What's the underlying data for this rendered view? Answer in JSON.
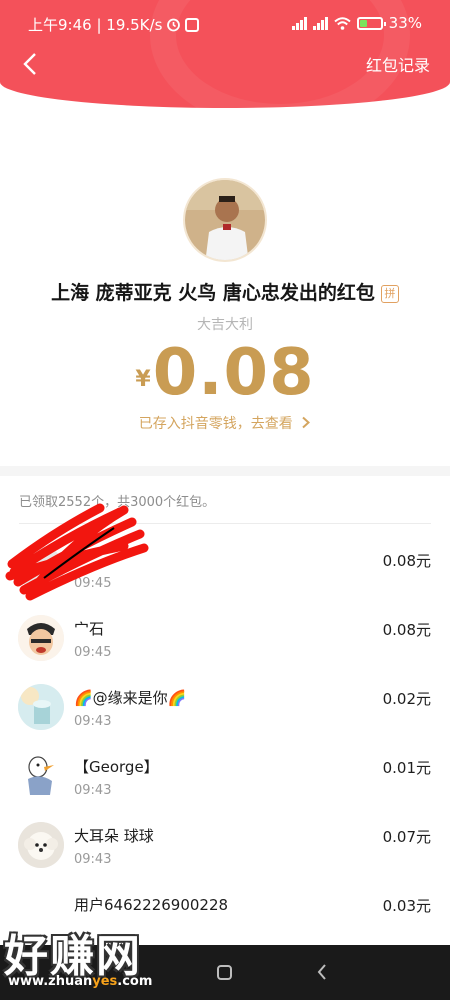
{
  "status_bar": {
    "time_speed": "上午9:46 | 19.5K/s",
    "battery": "33%",
    "battery_level": 0.33
  },
  "header": {
    "record_label": "红包记录",
    "back_icon": "chevron-left-icon"
  },
  "packet": {
    "sender": "上海 庞蒂亚克 火鸟 唐心忠发出的红包",
    "badge": "拼",
    "greeting": "大吉大利",
    "currency": "¥",
    "amount": "0.08",
    "stored_link": "已存入抖音零钱，去查看"
  },
  "summary": "已领取2552个，共3000个红包。",
  "receivers": [
    {
      "name": "",
      "time": "09:45",
      "amount": "0.08元"
    },
    {
      "name": "宀石",
      "time": "09:45",
      "amount": "0.08元"
    },
    {
      "name": "🌈@缘来是你🌈",
      "time": "09:43",
      "amount": "0.02元"
    },
    {
      "name": "【George】",
      "time": "09:43",
      "amount": "0.01元"
    },
    {
      "name": "大耳朵 球球",
      "time": "09:43",
      "amount": "0.07元"
    },
    {
      "name": "用户6462226900228",
      "time": "",
      "amount": "0.03元"
    }
  ],
  "watermark": {
    "text": "好赚网",
    "url_prefix": "www.zhuan",
    "url_accent": "yes",
    "url_suffix": ".com"
  },
  "colors": {
    "banner": "#f4515a",
    "gold": "#c99c53"
  }
}
